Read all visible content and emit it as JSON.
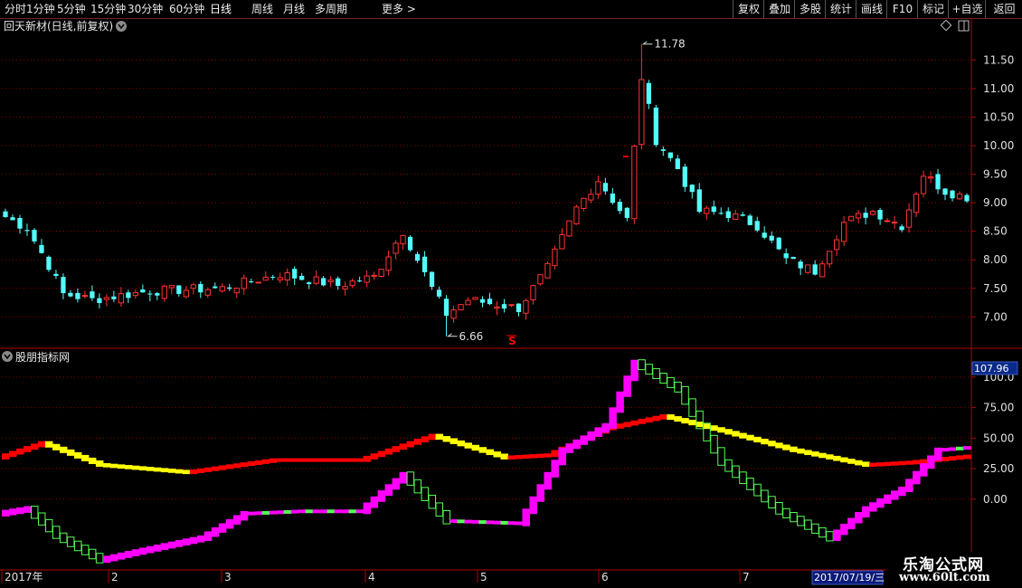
{
  "toolbar": {
    "left": [
      "分时",
      "1分钟",
      "5分钟",
      "15分钟",
      "30分钟",
      "60分钟",
      "日线",
      "周线",
      "月线",
      "多周期",
      "更多 >"
    ],
    "active": "日线",
    "right": [
      "复权",
      "叠加",
      "多股",
      "统计",
      "画线",
      "F10",
      "标记",
      "+自选",
      "返回"
    ]
  },
  "main_panel": {
    "title": "回天新材(日线,前复权)",
    "high_label": "11.78",
    "low_label": "6.66",
    "s_marker": "S"
  },
  "indicator_panel": {
    "title": "股朋指标网",
    "value_badge": "107.96"
  },
  "date_axis": {
    "labels": [
      "2017年",
      "2",
      "3",
      "4",
      "5",
      "6",
      "7"
    ],
    "cursor_date": "2017/07/19/三"
  },
  "watermark": {
    "line1": "乐淘公式网",
    "line2": "www.60lt.com"
  },
  "colors": {
    "up": "#ff3232",
    "down": "#54fcfc",
    "grid": "#8b0000",
    "axis": "#b00000",
    "magenta": "#ff00ff",
    "green": "#55ff55",
    "yellow": "#ffff00",
    "red": "#ff0000"
  },
  "chart_data": [
    {
      "type": "candlestick",
      "y_ticks": [
        "7.00",
        "7.50",
        "8.00",
        "8.50",
        "9.00",
        "9.50",
        "10.00",
        "10.50",
        "11.00",
        "11.50"
      ],
      "ylim": [
        6.45,
        11.95
      ],
      "n_days": 134,
      "annotations": {
        "high": 11.78,
        "low": 6.66
      },
      "anchors": [
        [
          0,
          8.75
        ],
        [
          3,
          8.55
        ],
        [
          6,
          7.9
        ],
        [
          8,
          7.4
        ],
        [
          12,
          7.3
        ],
        [
          20,
          7.45
        ],
        [
          30,
          7.5
        ],
        [
          38,
          7.75
        ],
        [
          46,
          7.55
        ],
        [
          51,
          7.7
        ],
        [
          55,
          8.5
        ],
        [
          59,
          7.5
        ],
        [
          61,
          7.05
        ],
        [
          64,
          7.3
        ],
        [
          71,
          7.15
        ],
        [
          75,
          7.85
        ],
        [
          79,
          8.9
        ],
        [
          82,
          9.4
        ],
        [
          86,
          8.7
        ],
        [
          88,
          11.2
        ],
        [
          90,
          10.1
        ],
        [
          93,
          9.6
        ],
        [
          96,
          8.85
        ],
        [
          100,
          8.8
        ],
        [
          104,
          8.6
        ],
        [
          108,
          8.0
        ],
        [
          112,
          7.8
        ],
        [
          116,
          8.65
        ],
        [
          120,
          8.85
        ],
        [
          124,
          8.6
        ],
        [
          127,
          9.5
        ],
        [
          130,
          9.2
        ],
        [
          133,
          9.1
        ]
      ]
    },
    {
      "type": "indicator",
      "y_ticks": [
        "0.00",
        "25.00",
        "50.00",
        "75.00",
        "100.0"
      ],
      "ylim": [
        -58,
        114
      ],
      "last_value": 107.96,
      "fast_anchors": [
        [
          0,
          -12
        ],
        [
          4,
          -8
        ],
        [
          8,
          -30
        ],
        [
          14,
          -50
        ],
        [
          20,
          -42
        ],
        [
          28,
          -32
        ],
        [
          34,
          -12
        ],
        [
          42,
          -10
        ],
        [
          50,
          -10
        ],
        [
          56,
          20
        ],
        [
          62,
          -18
        ],
        [
          72,
          -20
        ],
        [
          78,
          40
        ],
        [
          84,
          60
        ],
        [
          88,
          112
        ],
        [
          94,
          90
        ],
        [
          100,
          30
        ],
        [
          108,
          -10
        ],
        [
          115,
          -32
        ],
        [
          120,
          -8
        ],
        [
          125,
          8
        ],
        [
          130,
          40
        ],
        [
          134,
          42
        ]
      ],
      "slow_anchors": [
        [
          0,
          34
        ],
        [
          6,
          46
        ],
        [
          14,
          28
        ],
        [
          26,
          22
        ],
        [
          38,
          32
        ],
        [
          50,
          32
        ],
        [
          60,
          52
        ],
        [
          70,
          34
        ],
        [
          76,
          36
        ],
        [
          84,
          58
        ],
        [
          92,
          68
        ],
        [
          100,
          56
        ],
        [
          110,
          40
        ],
        [
          120,
          28
        ],
        [
          126,
          30
        ],
        [
          134,
          35
        ]
      ]
    }
  ]
}
